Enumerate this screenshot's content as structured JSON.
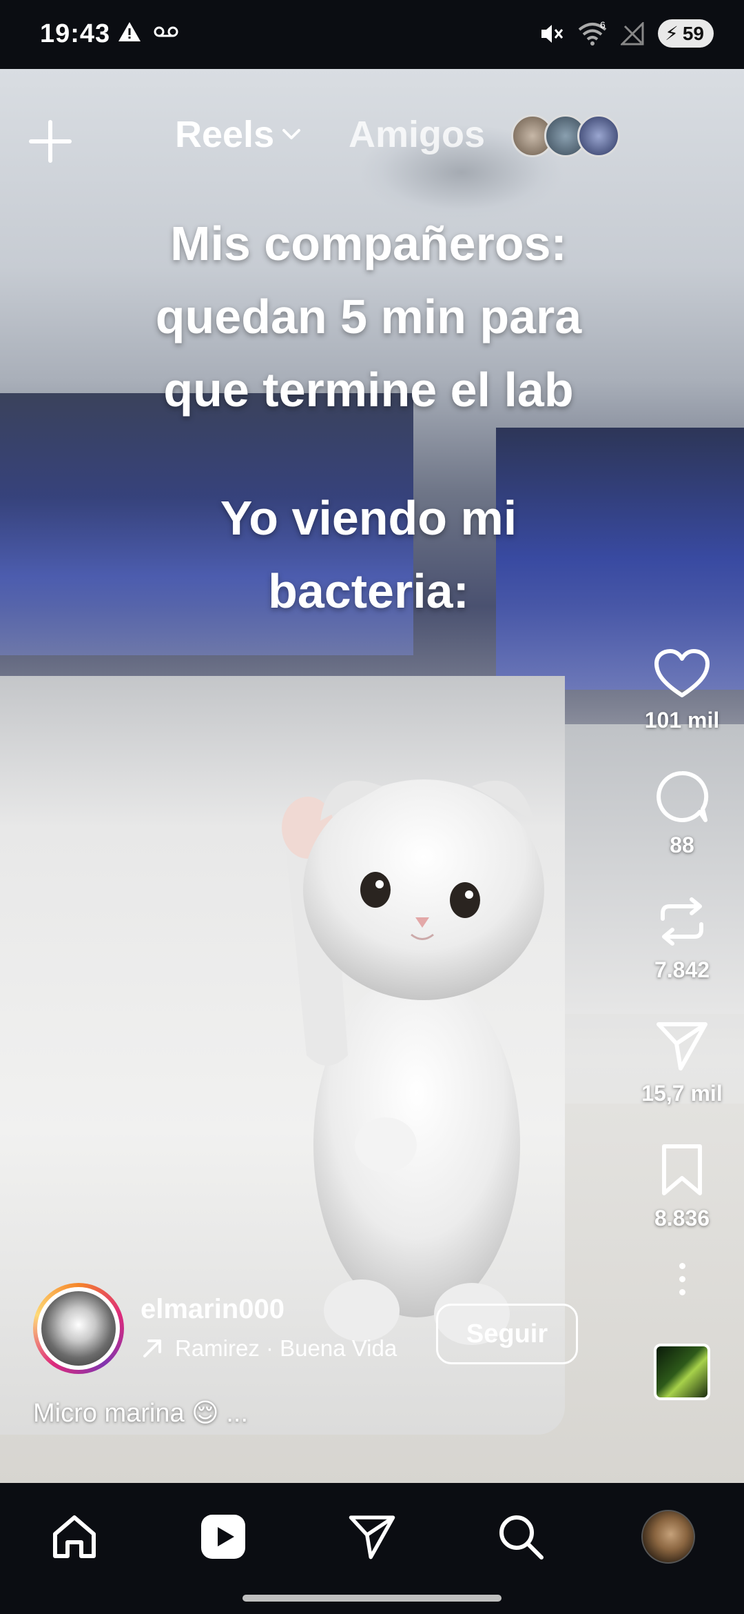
{
  "status": {
    "time": "19:43",
    "battery": "59",
    "signal_badge": "6"
  },
  "nav": {
    "reels_label": "Reels",
    "friends_label": "Amigos"
  },
  "overlay_text": {
    "line1": "Mis compañeros:",
    "line2": "quedan 5 min para",
    "line3": "que termine el lab",
    "line4": "Yo viendo mi",
    "line5": "bacteria:"
  },
  "actions": {
    "likes": "101 mil",
    "comments": "88",
    "reposts": "7.842",
    "shares": "15,7 mil",
    "saves": "8.836"
  },
  "author": {
    "username": "elmarin000",
    "audio": "Ramirez · Buena Vida",
    "follow_label": "Seguir"
  },
  "description": "Micro marina 😌 ..."
}
